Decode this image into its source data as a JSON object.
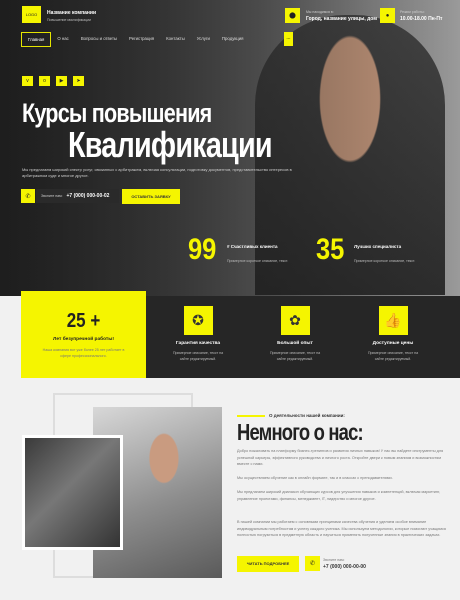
{
  "header": {
    "logo": "LOGO",
    "company_name": "Название компании",
    "company_desc": "Повышение квалификации",
    "address_label": "Мы находимся в:",
    "address": "Город, название улицы, дом",
    "hours_label": "Режим работы:",
    "hours": "10.00-18.00 Пн-Пт"
  },
  "nav": [
    "Главная",
    "О нас",
    "Вопросы и ответы",
    "Регистрация",
    "Контакты",
    "Услуги",
    "Продукция"
  ],
  "nav_more": "...",
  "hero": {
    "title1": "Курсы повышения",
    "title2": "Квалификации",
    "lead": "Мы предлагаем широкий спектр услуг, связанных с арбитражем, включая консультации, подготовку документов, представительство интересов в арбитражном суде и многое другое.",
    "phone_label": "Звоните нам:",
    "phone": "+7 (000) 000-00-02",
    "cta": "ОСТАВИТЬ ЗАЯВКУ"
  },
  "stats": [
    {
      "value": "99",
      "title": "# Счастливых клиента",
      "desc": "Примерное короткое описание, текст."
    },
    {
      "value": "35",
      "title": "Лучших специалиста",
      "desc": "Примерное короткое описание, текст."
    }
  ],
  "highlight": {
    "value": "25 +",
    "title": "Лет безупречной работы!",
    "desc": "Наша компания вот уже более 25 лет работает в сфере профессионального."
  },
  "features": [
    {
      "title": "Гарантия качества",
      "desc": "Примерное описание, текст на сайте редактируемый."
    },
    {
      "title": "Большой опыт",
      "desc": "Примерное описание, текст на сайте редактируемый."
    },
    {
      "title": "Доступные цены",
      "desc": "Примерное описание, текст на сайте редактируемый."
    }
  ],
  "about": {
    "eyebrow": "О деятельности нашей компании:",
    "title": "Немного о нас:",
    "p1": "Добро пожаловать на платформу бизнес-тренингов и развития личных навыков! У нас вы найдете инструменты для успешной карьеры, эффективного руководства и личного роста. Откройте двери к новым знаниям и возможностям вместе с нами.",
    "p2": "Мы осуществляем обучение как в онлайн формате, так и в классах с преподавателями.",
    "p3": "Мы предлагаем широкий диапазон обучающих курсов для улучшения навыков и компетенций, включая маркетинг, управление проектами, финансы, менеджмент, IT, лидерство и многое другое.",
    "p4": "В нашей компании мы работаем с основными принципами качества обучения и уделяем особое внимание индивидуальным потребностям и успеху каждого ученика. Мы используем методологии, которые помогают учащимся полностью погрузиться в предметную область и научиться применять полученные знания в практических задачах.",
    "cta": "ЧИТАТЬ ПОДРОБНЕЕ",
    "phone_label": "Звоните нам:",
    "phone": "+7 (000) 000-00-00"
  }
}
